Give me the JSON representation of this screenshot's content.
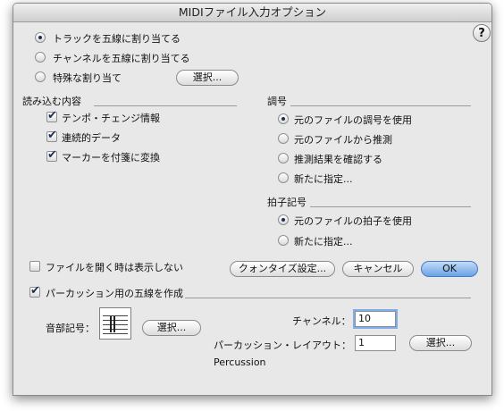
{
  "window": {
    "title": "MIDIファイル入力オプション"
  },
  "help_label": "?",
  "assign": {
    "options": [
      {
        "label": "トラックを五線に割り当てる",
        "selected": true
      },
      {
        "label": "チャンネルを五線に割り当てる",
        "selected": false
      },
      {
        "label": "特殊な割り当て",
        "selected": false
      }
    ],
    "select_button": "選択..."
  },
  "read": {
    "heading": "読み込む内容",
    "items": [
      {
        "label": "テンポ・チェンジ情報",
        "checked": true
      },
      {
        "label": "連続的データ",
        "checked": true
      },
      {
        "label": "マーカーを付箋に変換",
        "checked": true
      }
    ]
  },
  "key": {
    "heading": "調号",
    "options": [
      {
        "label": "元のファイルの調号を使用",
        "selected": true
      },
      {
        "label": "元のファイルから推測",
        "selected": false
      },
      {
        "label": "推測結果を確認する",
        "selected": false
      },
      {
        "label": "新たに指定...",
        "selected": false
      }
    ]
  },
  "time": {
    "heading": "拍子記号",
    "options": [
      {
        "label": "元のファイルの拍子を使用",
        "selected": true
      },
      {
        "label": "新たに指定...",
        "selected": false
      }
    ]
  },
  "hide_on_open": {
    "label": "ファイルを開く時は表示しない",
    "checked": false
  },
  "buttons": {
    "quantize": "クォンタイズ設定...",
    "cancel": "キャンセル",
    "ok": "OK"
  },
  "percussion": {
    "checkbox_label": "パーカッション用の五線を作成",
    "checked": true,
    "clef_label": "音部記号：",
    "clef_select": "選択...",
    "channel_label": "チャンネル：",
    "channel_value": "10",
    "layout_label": "パーカッション・レイアウト：",
    "layout_value": "1",
    "layout_select": "選択...",
    "layout_name": "Percussion"
  }
}
